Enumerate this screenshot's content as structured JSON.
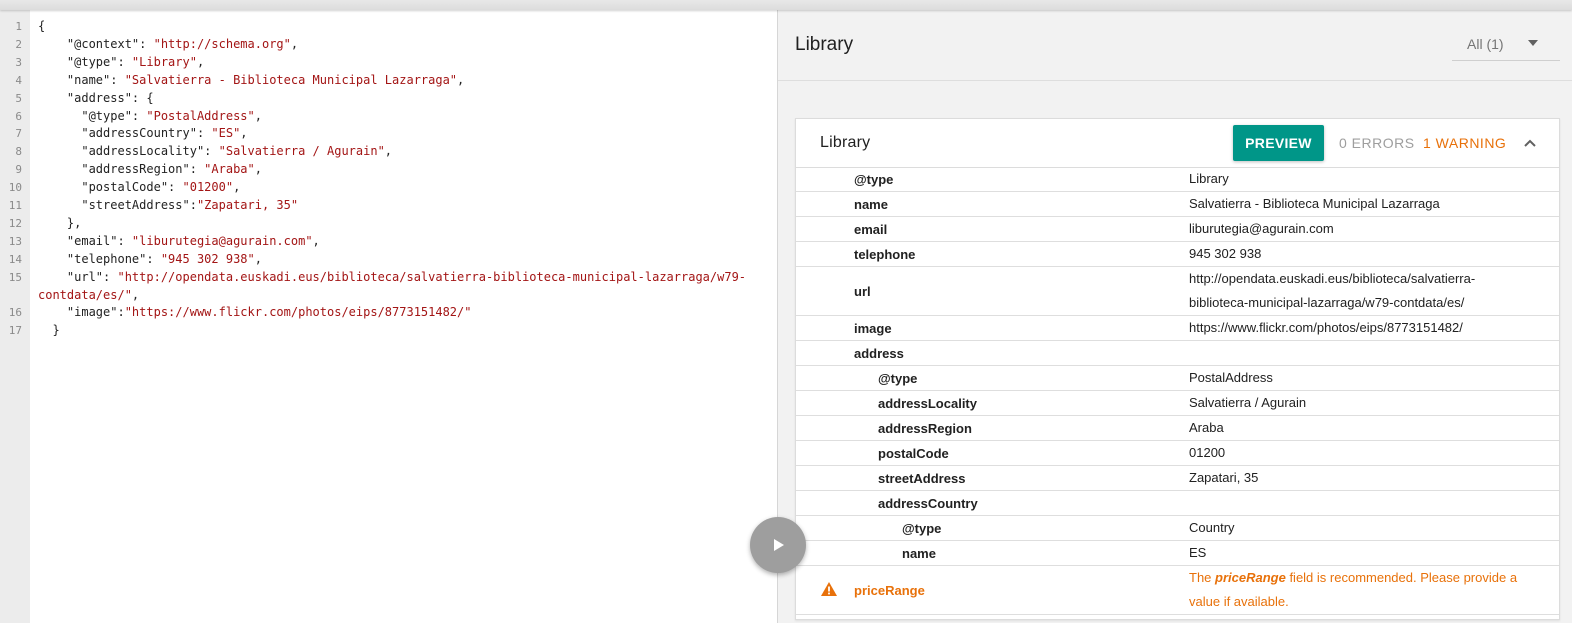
{
  "editor": {
    "lines": [
      {
        "n": "1",
        "parts": [
          {
            "t": "{",
            "c": "k"
          }
        ]
      },
      {
        "n": "2",
        "parts": [
          {
            "t": "    \"@context\": ",
            "c": "k"
          },
          {
            "t": "\"http://schema.org\"",
            "c": "v"
          },
          {
            "t": ",",
            "c": "k"
          }
        ]
      },
      {
        "n": "3",
        "parts": [
          {
            "t": "    \"@type\": ",
            "c": "k"
          },
          {
            "t": "\"Library\"",
            "c": "v"
          },
          {
            "t": ",",
            "c": "k"
          }
        ]
      },
      {
        "n": "4",
        "parts": [
          {
            "t": "    \"name\": ",
            "c": "k"
          },
          {
            "t": "\"Salvatierra - Biblioteca Municipal Lazarraga\"",
            "c": "v"
          },
          {
            "t": ",",
            "c": "k"
          }
        ]
      },
      {
        "n": "5",
        "parts": [
          {
            "t": "    \"address\": {",
            "c": "k"
          }
        ]
      },
      {
        "n": "6",
        "parts": [
          {
            "t": "      \"@type\": ",
            "c": "k"
          },
          {
            "t": "\"PostalAddress\"",
            "c": "v"
          },
          {
            "t": ",",
            "c": "k"
          }
        ]
      },
      {
        "n": "7",
        "parts": [
          {
            "t": "      \"addressCountry\": ",
            "c": "k"
          },
          {
            "t": "\"ES\"",
            "c": "v"
          },
          {
            "t": ",",
            "c": "k"
          }
        ]
      },
      {
        "n": "8",
        "parts": [
          {
            "t": "      \"addressLocality\": ",
            "c": "k"
          },
          {
            "t": "\"Salvatierra / Agurain\"",
            "c": "v"
          },
          {
            "t": ",",
            "c": "k"
          }
        ]
      },
      {
        "n": "9",
        "parts": [
          {
            "t": "      \"addressRegion\": ",
            "c": "k"
          },
          {
            "t": "\"Araba\"",
            "c": "v"
          },
          {
            "t": ",",
            "c": "k"
          }
        ]
      },
      {
        "n": "10",
        "parts": [
          {
            "t": "      \"postalCode\": ",
            "c": "k"
          },
          {
            "t": "\"01200\"",
            "c": "v"
          },
          {
            "t": ",",
            "c": "k"
          }
        ]
      },
      {
        "n": "11",
        "parts": [
          {
            "t": "      \"streetAddress\":",
            "c": "k"
          },
          {
            "t": "\"Zapatari, 35\"",
            "c": "v"
          }
        ]
      },
      {
        "n": "12",
        "parts": [
          {
            "t": "    },",
            "c": "k"
          }
        ]
      },
      {
        "n": "13",
        "parts": [
          {
            "t": "    \"email\": ",
            "c": "k"
          },
          {
            "t": "\"liburutegia@agurain.com\"",
            "c": "v"
          },
          {
            "t": ",",
            "c": "k"
          }
        ]
      },
      {
        "n": "14",
        "parts": [
          {
            "t": "    \"telephone\": ",
            "c": "k"
          },
          {
            "t": "\"945 302 938\"",
            "c": "v"
          },
          {
            "t": ",",
            "c": "k"
          }
        ]
      },
      {
        "n": "15",
        "tall": true,
        "parts": [
          {
            "t": "    \"url\": ",
            "c": "k"
          },
          {
            "t": "\"http://opendata.euskadi.eus/biblioteca/salvatierra-biblioteca-municipal-lazarraga/w79-contdata/es/\"",
            "c": "v"
          },
          {
            "t": ",",
            "c": "k"
          }
        ]
      },
      {
        "n": "16",
        "parts": [
          {
            "t": "    \"image\":",
            "c": "k"
          },
          {
            "t": "\"https://www.flickr.com/photos/eips/8773151482/\"",
            "c": "v"
          }
        ]
      },
      {
        "n": "17",
        "parts": [
          {
            "t": "  }",
            "c": "k"
          }
        ]
      }
    ]
  },
  "panel": {
    "title": "Library",
    "filter_label": "All (1)"
  },
  "card": {
    "title": "Library",
    "preview_label": "PREVIEW",
    "errors_label": "0 ERRORS",
    "warnings_label": "1 WARNING"
  },
  "rows": [
    {
      "level": 0,
      "key": "@type",
      "value": "Library"
    },
    {
      "level": 0,
      "key": "name",
      "value": "Salvatierra - Biblioteca Municipal Lazarraga"
    },
    {
      "level": 0,
      "key": "email",
      "value": "liburutegia@agurain.com"
    },
    {
      "level": 0,
      "key": "telephone",
      "value": "945 302 938"
    },
    {
      "level": 0,
      "key": "url",
      "value": "http://opendata.euskadi.eus/biblioteca/salvatierra-biblioteca-municipal-lazarraga/w79-contdata/es/",
      "tall": true
    },
    {
      "level": 0,
      "key": "image",
      "value": "https://www.flickr.com/photos/eips/8773151482/"
    },
    {
      "level": 0,
      "key": "address",
      "value": ""
    },
    {
      "level": 1,
      "key": "@type",
      "value": "PostalAddress"
    },
    {
      "level": 1,
      "key": "addressLocality",
      "value": "Salvatierra / Agurain"
    },
    {
      "level": 1,
      "key": "addressRegion",
      "value": "Araba"
    },
    {
      "level": 1,
      "key": "postalCode",
      "value": "01200"
    },
    {
      "level": 1,
      "key": "streetAddress",
      "value": "Zapatari, 35"
    },
    {
      "level": 1,
      "key": "addressCountry",
      "value": ""
    },
    {
      "level": 2,
      "key": "@type",
      "value": "Country"
    },
    {
      "level": 2,
      "key": "name",
      "value": "ES"
    }
  ],
  "warning": {
    "key": "priceRange",
    "msg_before": "The ",
    "msg_field": "priceRange",
    "msg_after": " field is recommended. Please provide a value if available.",
    "icon": "warning-triangle-icon"
  },
  "colors": {
    "accent": "#009688",
    "warning": "#e8710a",
    "code_string": "#a31515"
  }
}
